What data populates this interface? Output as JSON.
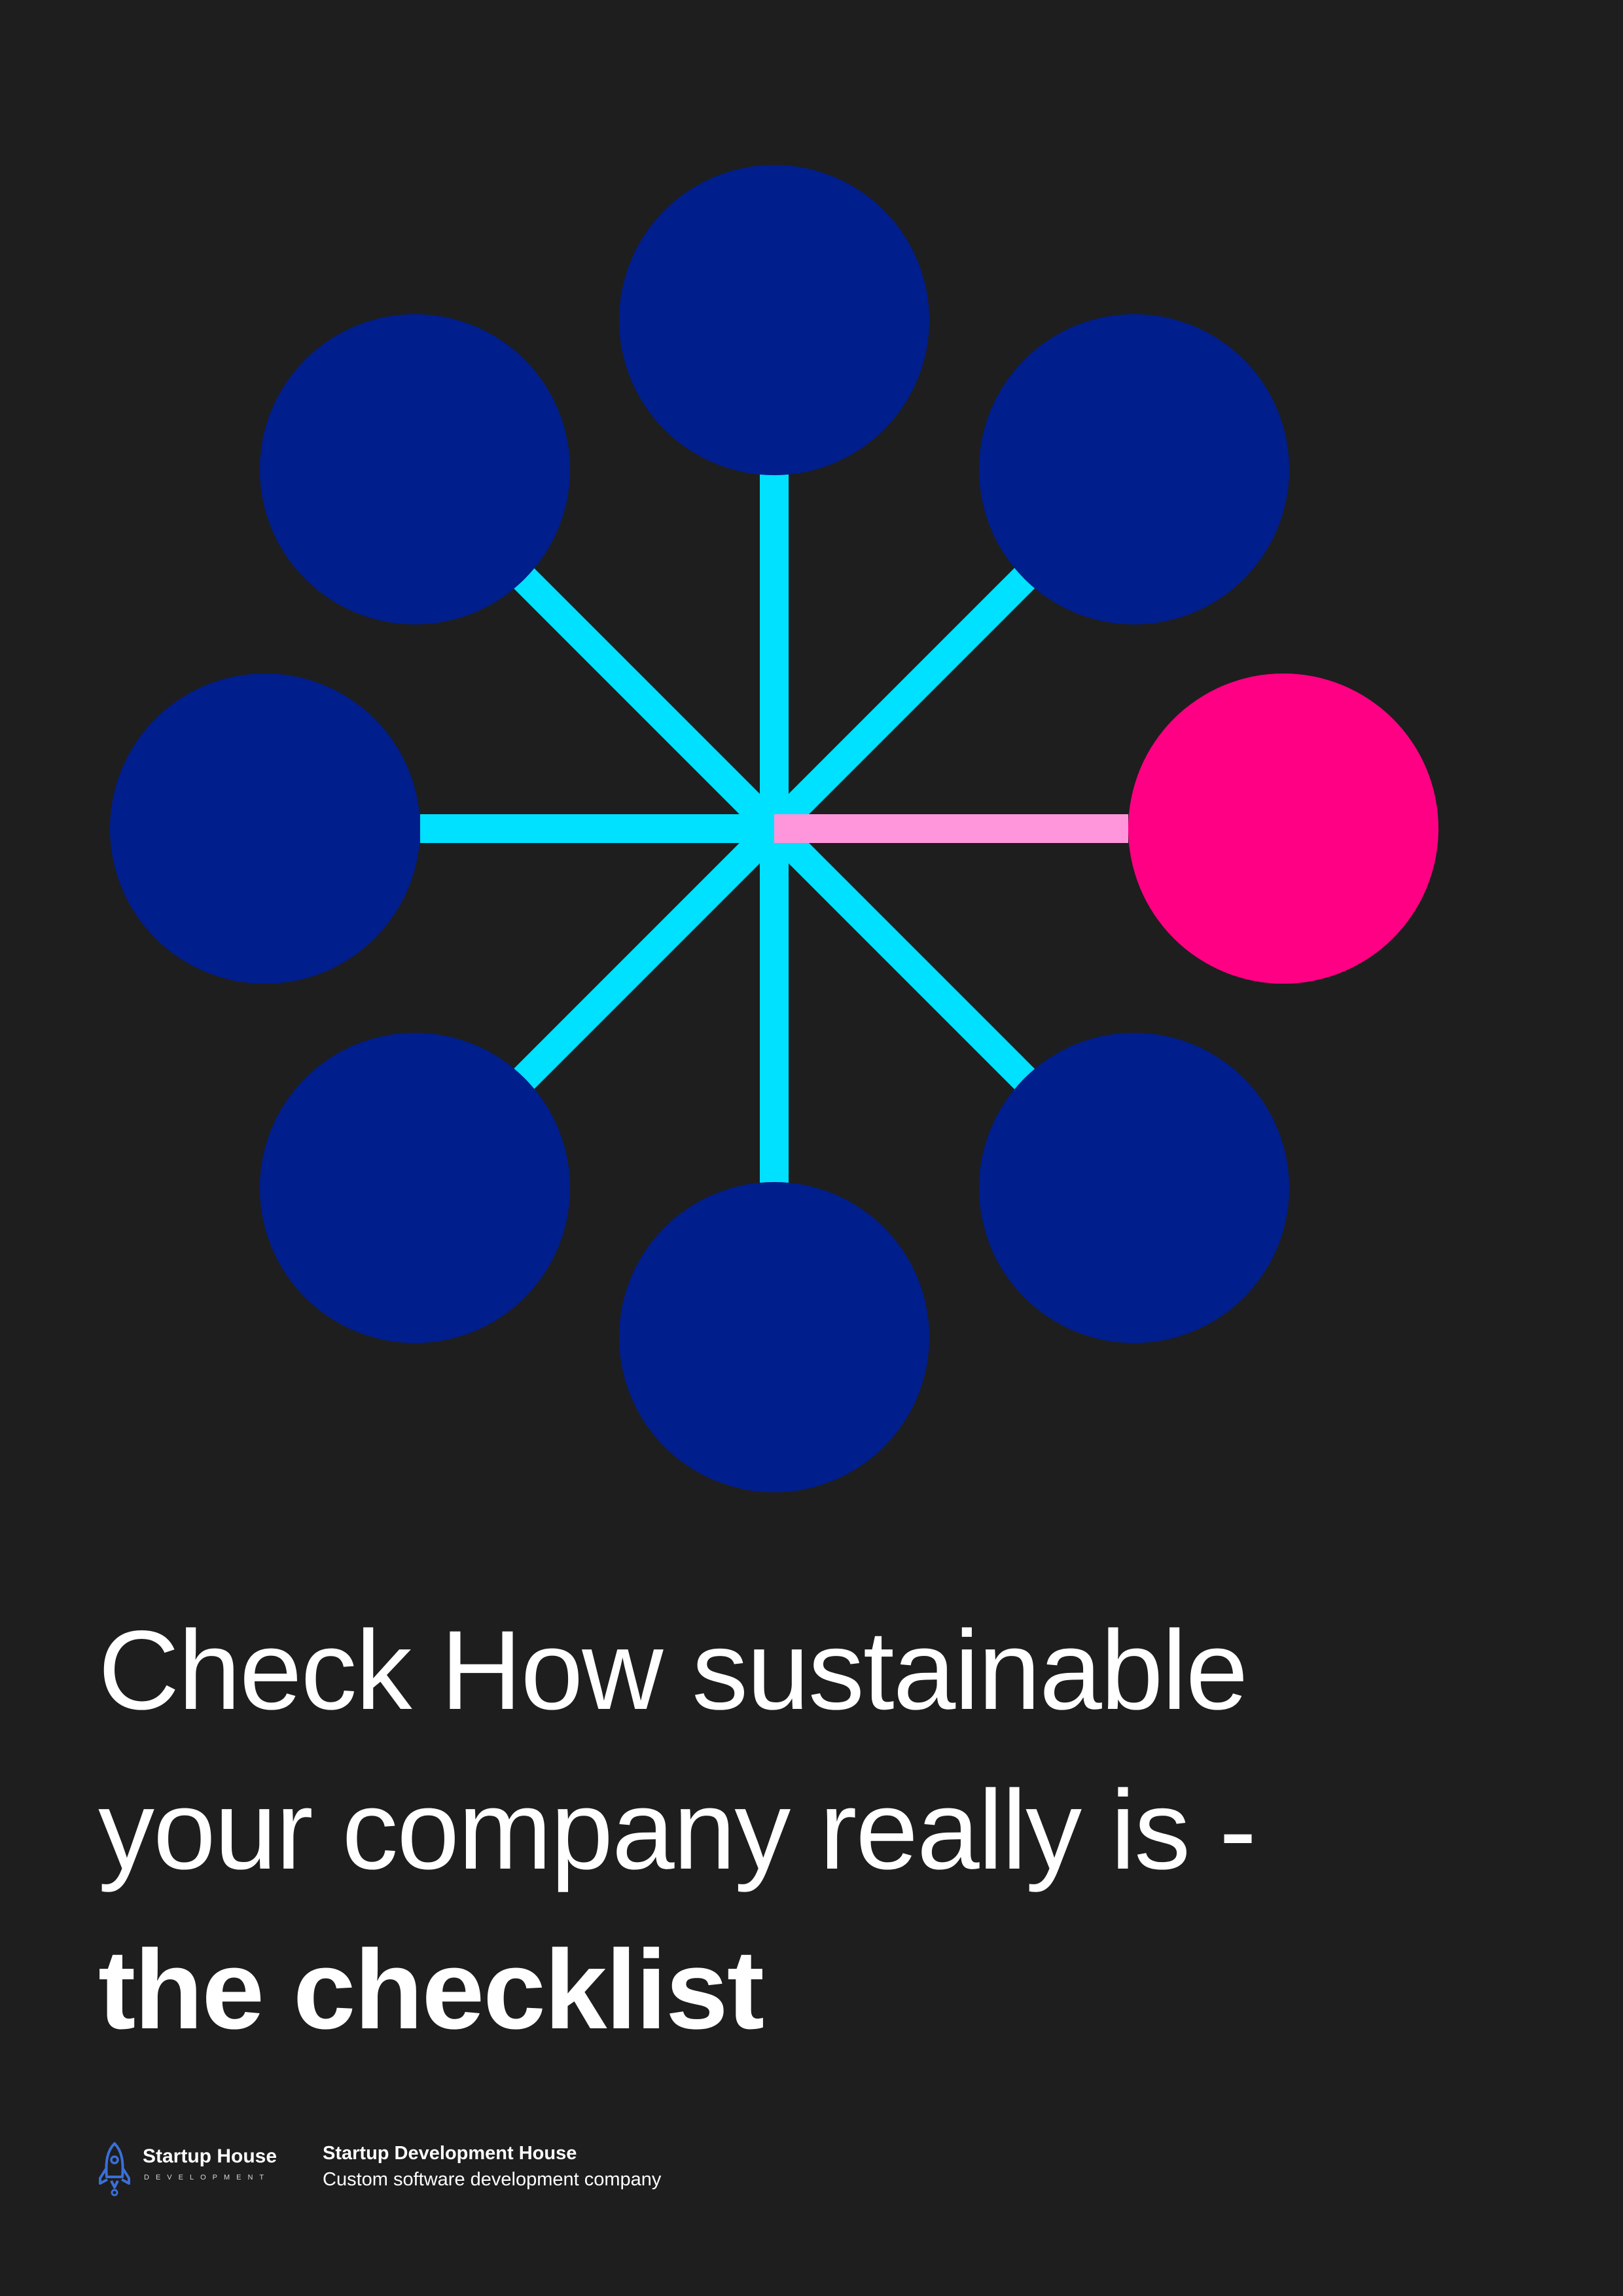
{
  "title": {
    "line1": "Check How sustainable",
    "line2": "your company really is -",
    "line3": "the checklist"
  },
  "footer": {
    "logo_name": "Startup House",
    "logo_sub": "DEVELOPMENT",
    "company_name": "Startup Development House",
    "company_desc": "Custom software development company"
  },
  "colors": {
    "background": "#1e1e1e",
    "node": "#001e8c",
    "node_highlight": "#ff0084",
    "spoke": "#00e0ff",
    "spoke_highlight": "#ff96dc",
    "logo_icon": "#3a6fd8"
  },
  "icons": {
    "logo": "rocket-icon"
  }
}
